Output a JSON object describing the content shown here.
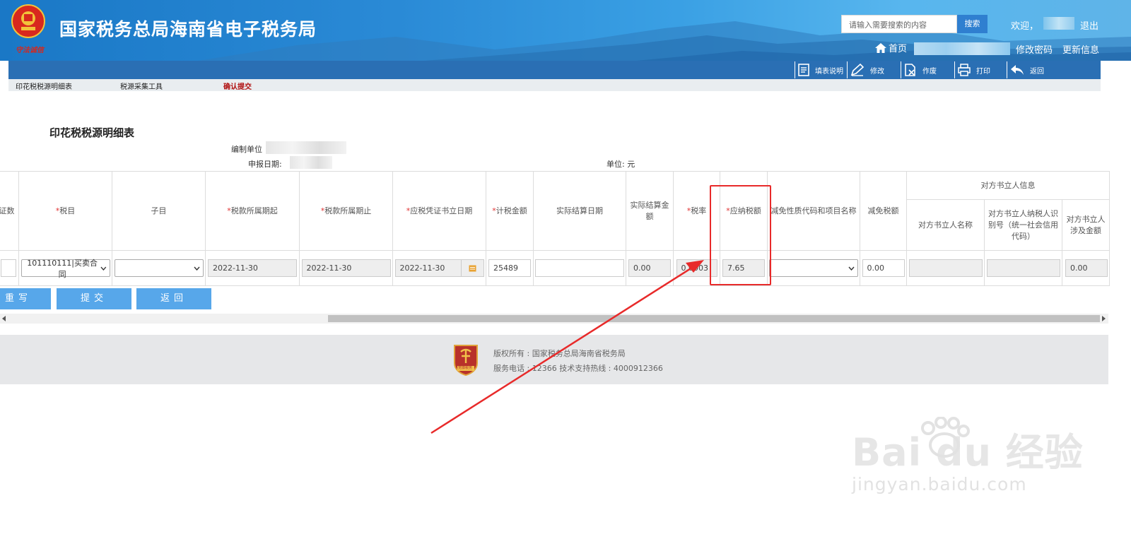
{
  "header": {
    "site_title": "国家税务总局海南省电子税务局",
    "emblem_motto": "守法诚信",
    "search_placeholder": "请输入需要搜索的内容",
    "search_button": "搜索",
    "welcome": "欢迎，",
    "logout": "退出",
    "home": "首页",
    "change_password": "修改密码",
    "update_info": "更新信息"
  },
  "toolbar": {
    "fill_instructions": "填表说明",
    "modify": "修改",
    "void": "作废",
    "print": "打印",
    "back": "返回"
  },
  "subtabs": [
    "印花税税源明细表",
    "税源采集工具",
    "确认提交"
  ],
  "form": {
    "title": "印花税税源明细表",
    "prepared_by_label": "编制单位",
    "report_date_label": "申报日期:",
    "unit_label": "单位: 元"
  },
  "table": {
    "headers": {
      "col0": "证数",
      "tax_item": "税目",
      "sub_item": "子目",
      "period_start": "税款所属期起",
      "period_end": "税款所属期止",
      "voucher_date": "应税凭证书立日期",
      "taxable_amount": "计税金额",
      "actual_settle_date": "实际结算日期",
      "actual_settle_amount": "实际结算金额",
      "tax_rate": "税率",
      "tax_payable": "应纳税额",
      "relief_code": "减免性质代码和项目名称",
      "relief_amount": "减免税额",
      "counterparty_group": "对方书立人信息",
      "cp_name": "对方书立人名称",
      "cp_taxid": "对方书立人纳税人识别号（统一社会信用代码）",
      "cp_amount": "对方书立人涉及金额"
    },
    "required_mark": "*",
    "row": {
      "tax_item": "101110111|买卖合同",
      "sub_item": "",
      "period_start": "2022-11-30",
      "period_end": "2022-11-30",
      "voucher_date": "2022-11-30",
      "taxable_amount": "25489",
      "actual_settle_date": "",
      "actual_settle_amount": "0.00",
      "tax_rate": "0.0003",
      "tax_payable": "7.65",
      "relief_code": "",
      "relief_amount": "0.00",
      "cp_name": "",
      "cp_taxid": "",
      "cp_amount": "0.00"
    }
  },
  "actions": {
    "reset": "重写",
    "submit": "提交",
    "back": "返回"
  },
  "footer": {
    "copyright": "版权所有 : 国家税务总局海南省税务局",
    "service": "服务电话 : 12366 技术支持热线 : 4000912366",
    "logo_text": "党旗税务"
  },
  "watermark": {
    "brand": "Bai du 经验",
    "url": "jingyan.baidu.com"
  },
  "colors": {
    "header_blue": "#1a78c6",
    "toolbar_blue": "#2a6fb4",
    "button_blue": "#57a7ea",
    "annotation_red": "#e82a2a"
  }
}
